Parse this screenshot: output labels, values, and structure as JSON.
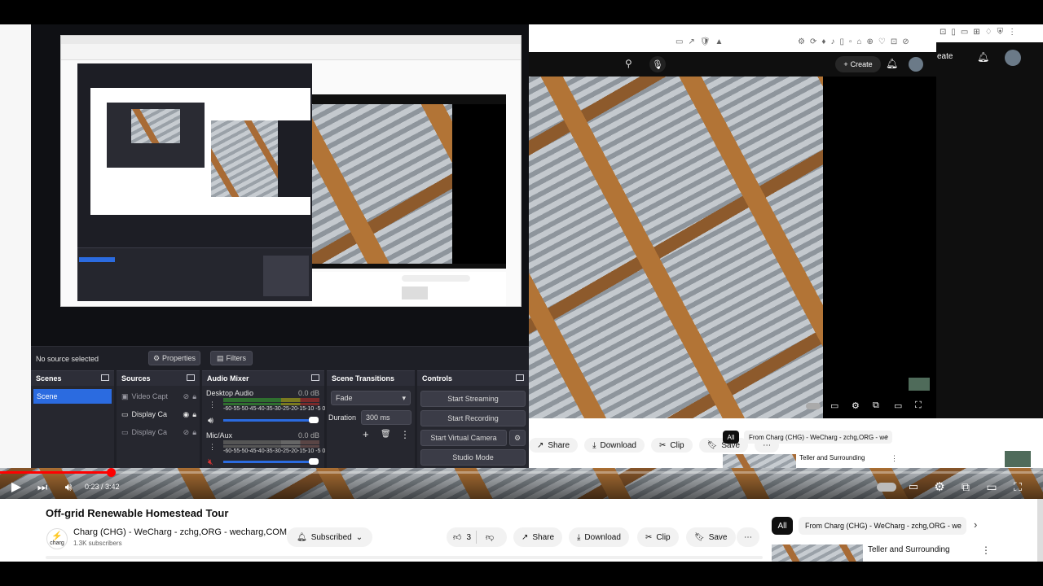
{
  "obs": {
    "status": "No source selected",
    "properties_label": "Properties",
    "filters_label": "Filters",
    "docks": {
      "scenes": "Scenes",
      "sources": "Sources",
      "audio_mixer": "Audio Mixer",
      "scene_transitions": "Scene Transitions",
      "controls": "Controls"
    },
    "scene_item": "Scene",
    "sources_list": [
      "Video Capt",
      "Display Ca",
      "Display Ca"
    ],
    "audio": {
      "desktop_label": "Desktop Audio",
      "desktop_db": "0.0 dB",
      "mic_label": "Mic/Aux",
      "mic_db": "0.0 dB",
      "meter_scale": "-60-55-50-45-40-35-30-25-20-15-10 -5 0"
    },
    "transition": {
      "value": "Fade",
      "duration_label": "Duration",
      "duration_value": "300 ms"
    },
    "controls": [
      "Start Streaming",
      "Start Recording",
      "Start Virtual Camera",
      "Studio Mode"
    ]
  },
  "browser": {
    "create_label": "Create",
    "create_label_right": "eate"
  },
  "mini_actions": [
    "Share",
    "Download",
    "Clip",
    "Save"
  ],
  "mini_chips": [
    "All",
    "From Charg (CHG) - WeCharg - zchg,ORG - we"
  ],
  "mini_rec_title": "Teller and Surrounding",
  "player": {
    "time": "0:23 / 3:42"
  },
  "video": {
    "title": "Off-grid Renewable Homestead Tour",
    "channel": "Charg (CHG) - WeCharg - zchg,ORG - wecharg,COM",
    "subscribers": "1.3K subscribers",
    "subscribed_label": "Subscribed",
    "like_count": "3",
    "share_label": "Share",
    "download_label": "Download",
    "clip_label": "Clip",
    "save_label": "Save",
    "avatar_text": "charg"
  },
  "chips": [
    "All",
    "From Charg (CHG) - WeCharg - zchg,ORG - we"
  ],
  "recommendation": {
    "title": "Teller and Surrounding"
  },
  "colors": {
    "accent_red": "#ff0000",
    "obs_blue": "#2b6be0",
    "obs_bg": "#1e1f26"
  }
}
